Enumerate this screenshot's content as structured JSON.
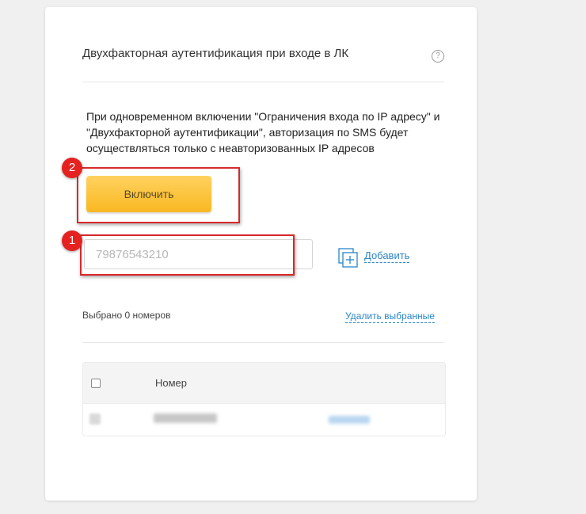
{
  "card": {
    "title": "Двухфакторная аутентификация при входе в ЛК",
    "help_glyph": "?",
    "notice": "При одновременном включении \"Ограничения входа по IP адресу\" и \"Двухфакторной аутентификации\", авторизация по SMS будет осуществляться только с неавторизованных IP адресов",
    "enable_button": "Включить",
    "phone_input": {
      "value": "",
      "placeholder": "79876543210"
    },
    "add_link": "Добавить",
    "selected_count": "Выбрано 0 номеров",
    "delete_selected": "Удалить выбранные",
    "table": {
      "header_number": "Номер"
    }
  },
  "annotations": {
    "badge_1": "1",
    "badge_2": "2"
  },
  "colors": {
    "accent_link": "#2a86c8",
    "button_yellow": "#f9b821",
    "highlight_red": "#d8282a"
  }
}
